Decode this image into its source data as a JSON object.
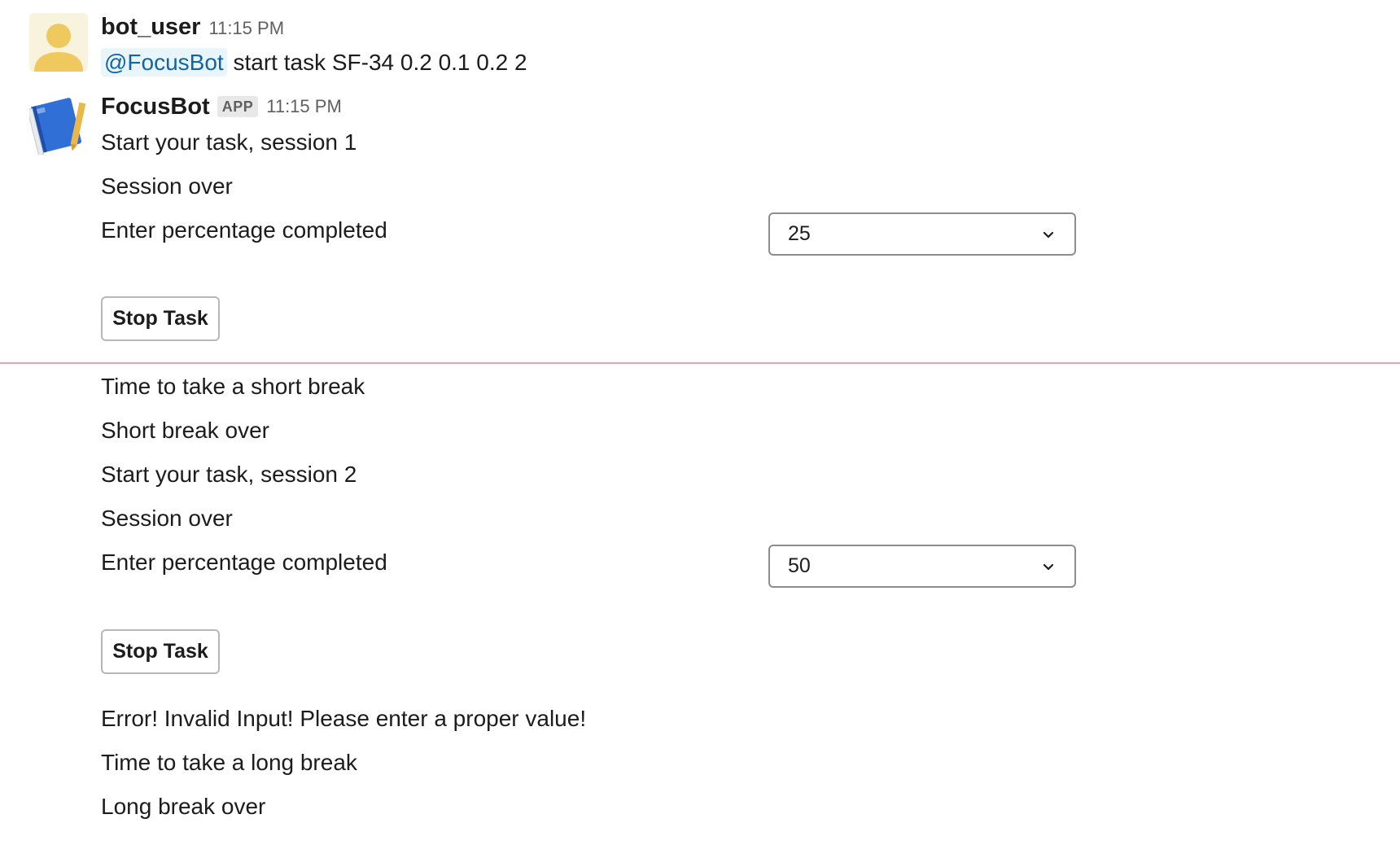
{
  "message_user": {
    "sender": "bot_user",
    "time": "11:15 PM",
    "mention": "@FocusBot",
    "text": "start task SF-34 0.2 0.1 0.2 2"
  },
  "message_bot": {
    "sender": "FocusBot",
    "badge": "APP",
    "time": "11:15 PM",
    "block1": {
      "line1": "Start your task, session 1",
      "line2": "Session over",
      "prompt": "Enter percentage completed",
      "select_value": "25",
      "button": "Stop Task"
    },
    "block2": {
      "line1": "Time to take a short break",
      "line2": "Short break over",
      "line3": "Start your task, session 2",
      "line4": "Session over",
      "prompt": "Enter percentage completed",
      "select_value": "50",
      "button": "Stop Task"
    },
    "block3": {
      "line1": "Error! Invalid Input! Please enter a proper value!",
      "line2": "Time to take a long break",
      "line3": "Long break over"
    }
  },
  "icons": {
    "user_avatar": "person-icon",
    "bot_avatar": "notebook-pencil-icon",
    "dropdown": "chevron-down-icon"
  },
  "colors": {
    "mention_text": "#1264a3",
    "mention_bg": "#e8f5fa",
    "new_divider": "#e8a0b4",
    "avatar_yellow": "#efc95e"
  }
}
